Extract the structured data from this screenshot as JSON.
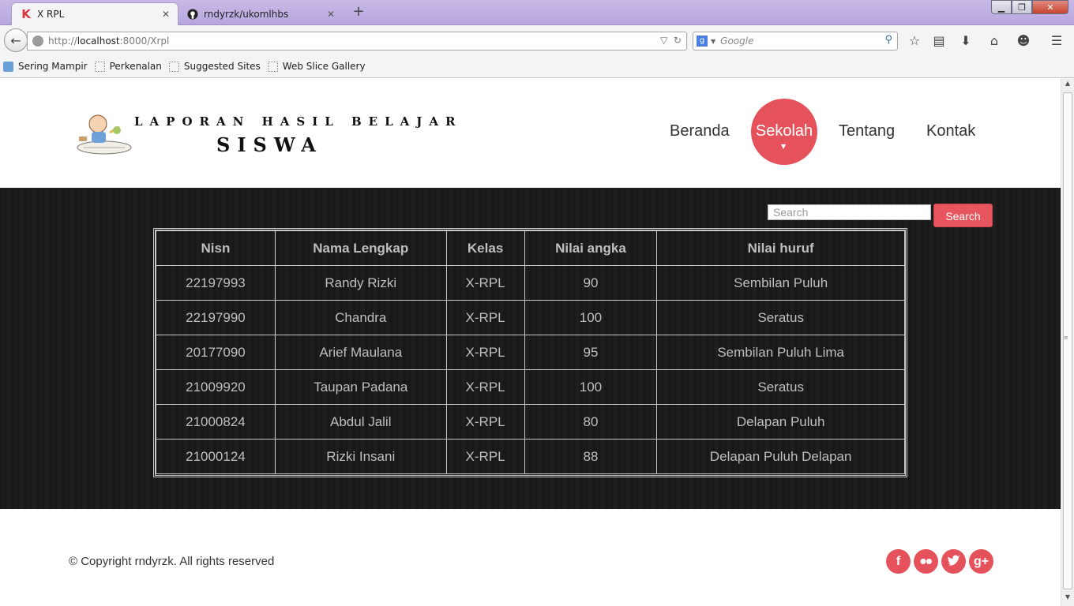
{
  "browser": {
    "tabs": [
      {
        "title": "X RPL",
        "icon": "k-logo-icon",
        "active": true
      },
      {
        "title": "rndyrzk/ukomlhbs",
        "icon": "github-icon",
        "active": false
      }
    ],
    "url_prefix": "http://",
    "url_host": "localhost",
    "url_rest": ":8000/Xrpl",
    "search_placeholder": "Google",
    "bookmarks": [
      "Sering Mampir",
      "Perkenalan",
      "Suggested Sites",
      "Web Slice Gallery"
    ]
  },
  "site": {
    "logo_line1": "LAPORAN HASIL BELAJAR",
    "logo_line2": "SISWA",
    "nav": {
      "home": "Beranda",
      "school": "Sekolah",
      "about": "Tentang",
      "contact": "Kontak"
    },
    "accent_color": "#e5525b"
  },
  "search": {
    "placeholder": "Search",
    "button": "Search"
  },
  "table": {
    "headers": [
      "Nisn",
      "Nama Lengkap",
      "Kelas",
      "Nilai angka",
      "Nilai huruf"
    ],
    "rows": [
      [
        "22197993",
        "Randy Rizki",
        "X-RPL",
        "90",
        "Sembilan Puluh"
      ],
      [
        "22197990",
        "Chandra",
        "X-RPL",
        "100",
        "Seratus"
      ],
      [
        "20177090",
        "Arief Maulana",
        "X-RPL",
        "95",
        "Sembilan Puluh Lima"
      ],
      [
        "21009920",
        "Taupan Padana",
        "X-RPL",
        "100",
        "Seratus"
      ],
      [
        "21000824",
        "Abdul Jalil",
        "X-RPL",
        "80",
        "Delapan Puluh"
      ],
      [
        "21000124",
        "Rizki Insani",
        "X-RPL",
        "88",
        "Delapan Puluh Delapan"
      ]
    ]
  },
  "footer": {
    "copyright": "© Copyright rndyrzk. All rights reserved",
    "social": [
      "facebook-icon",
      "flickr-icon",
      "twitter-icon",
      "google-plus-icon"
    ]
  }
}
